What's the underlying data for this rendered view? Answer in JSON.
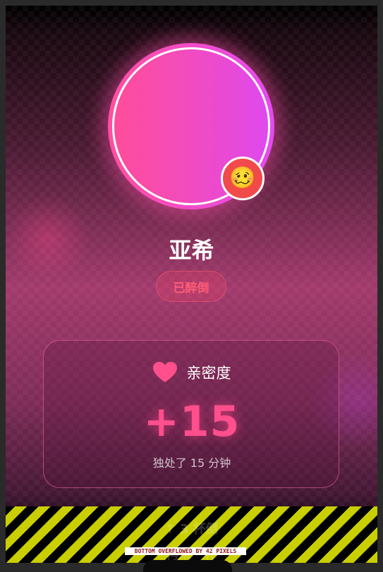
{
  "profile": {
    "name": "亚希",
    "status_label": "已醉倒",
    "status_emoji": "🥴",
    "status_emoji_name": "woozy-face-icon"
  },
  "intimacy_card": {
    "icon": "heart-icon",
    "title": "亲密度",
    "value": "+15",
    "subtitle": "独处了 15 分钟"
  },
  "hidden_action": {
    "label": "↑ 3 杯倒",
    "secondary": "再来一杯"
  },
  "debug": {
    "overflow_message": "BOTTOM OVERFLOWED BY 42 PIXELS"
  },
  "colors": {
    "accent_pink": "#ff4f8c",
    "avatar_gradient_start": "#ff4fa0",
    "avatar_gradient_end": "#e54af2",
    "status_red": "#ff5b77",
    "stripe_yellow": "#c9cf00"
  }
}
